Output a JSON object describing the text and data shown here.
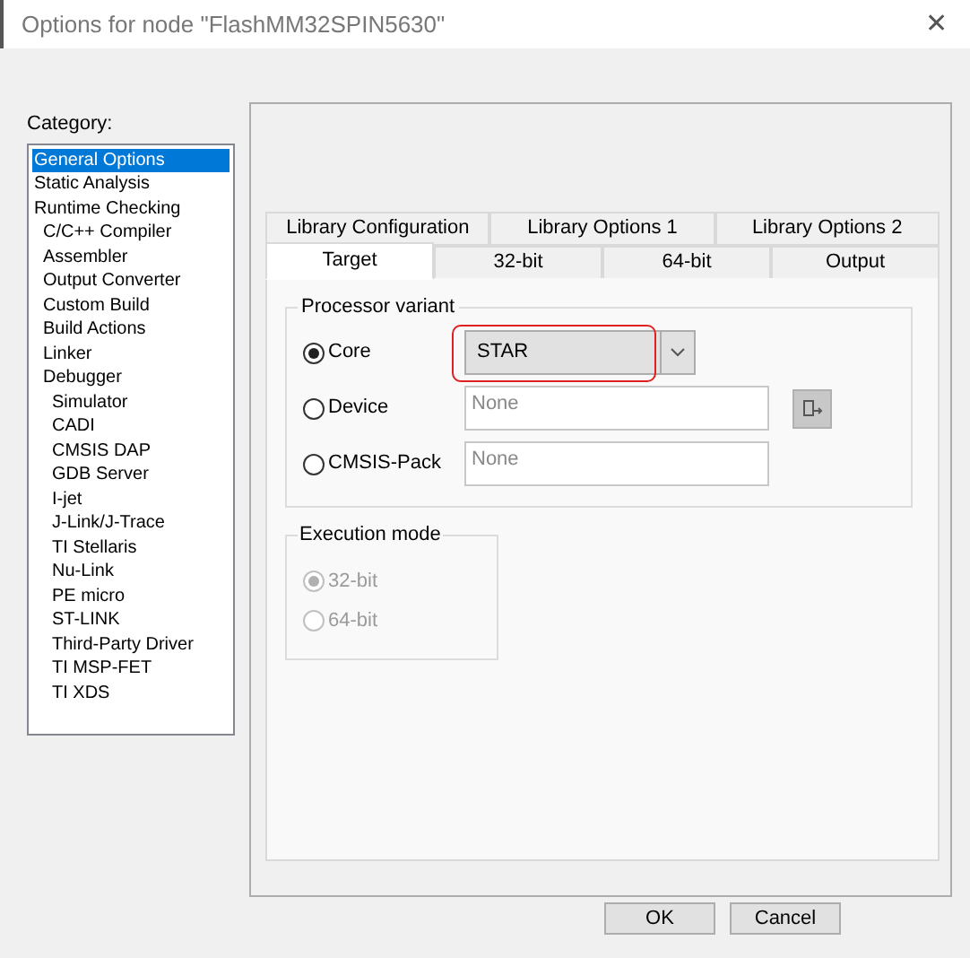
{
  "window": {
    "title": "Options for node \"FlashMM32SPIN5630\"",
    "close": "✕"
  },
  "category": {
    "label": "Category:",
    "items": [
      {
        "label": "General Options",
        "selected": true
      },
      {
        "label": "Static Analysis",
        "selected": false
      },
      {
        "label": "Runtime Checking",
        "selected": false,
        "children": [
          {
            "label": "C/C++ Compiler",
            "selected": false
          },
          {
            "label": "Assembler",
            "selected": false
          },
          {
            "label": "Output Converter",
            "selected": false
          },
          {
            "label": "Custom Build",
            "selected": false
          },
          {
            "label": "Build Actions",
            "selected": false
          },
          {
            "label": "Linker",
            "selected": false
          },
          {
            "label": "Debugger",
            "selected": false,
            "children": [
              {
                "label": "Simulator",
                "selected": false
              },
              {
                "label": "CADI",
                "selected": false
              },
              {
                "label": "CMSIS DAP",
                "selected": false
              },
              {
                "label": "GDB Server",
                "selected": false
              },
              {
                "label": "I-jet",
                "selected": false
              },
              {
                "label": "J-Link/J-Trace",
                "selected": false
              },
              {
                "label": "TI Stellaris",
                "selected": false
              },
              {
                "label": "Nu-Link",
                "selected": false
              },
              {
                "label": "PE micro",
                "selected": false
              },
              {
                "label": "ST-LINK",
                "selected": false
              },
              {
                "label": "Third-Party Driver",
                "selected": false
              },
              {
                "label": "TI MSP-FET",
                "selected": false
              },
              {
                "label": "TI XDS",
                "selected": false
              }
            ]
          }
        ]
      }
    ]
  },
  "tab_rows": [
    [
      {
        "label": "Library Configuration",
        "selected": false
      },
      {
        "label": "Library Options 1",
        "selected": false
      },
      {
        "label": "Library Options 2",
        "selected": false
      }
    ],
    [
      {
        "label": "Target",
        "selected": true
      },
      {
        "label": "32-bit",
        "selected": false
      },
      {
        "label": "64-bit",
        "selected": false
      },
      {
        "label": "Output",
        "selected": false
      }
    ]
  ],
  "processor_variant": {
    "title": "Processor variant",
    "options": [
      {
        "label": "Core",
        "selected": true,
        "kind": "dropdown",
        "value": "STAR",
        "highlighted": true
      },
      {
        "label": "Device",
        "selected": false,
        "kind": "field",
        "placeholder": "None",
        "has_button": true
      },
      {
        "label": "CMSIS-Pack",
        "selected": false,
        "kind": "field",
        "placeholder": "None"
      }
    ]
  },
  "execution_mode": {
    "title": "Execution mode",
    "disabled": true,
    "options": [
      {
        "label": "32-bit",
        "selected": true
      },
      {
        "label": "64-bit",
        "selected": false
      }
    ]
  },
  "buttons": [
    "OK",
    "Cancel"
  ]
}
